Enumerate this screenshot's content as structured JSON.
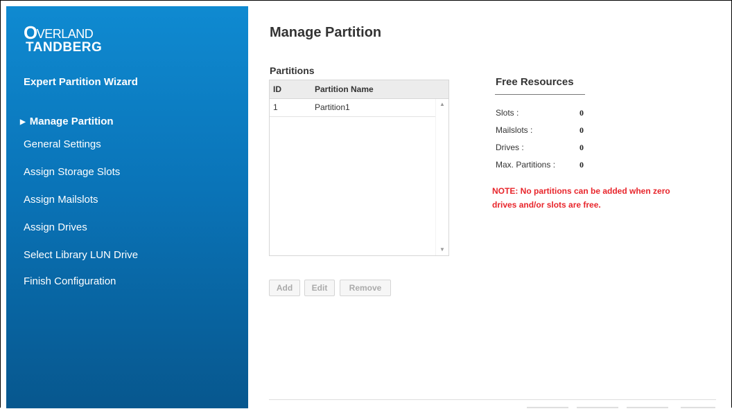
{
  "sidebar": {
    "logo_top": "VERLAND",
    "logo_o": "O",
    "logo_bottom": "TANDBERG",
    "wizard_title": "Expert Partition Wizard",
    "items": [
      {
        "label": "Manage Partition",
        "active": true
      },
      {
        "label": "General Settings"
      },
      {
        "label": "Assign Storage Slots"
      },
      {
        "label": "Assign Mailslots"
      },
      {
        "label": "Assign Drives"
      },
      {
        "label": "Select Library LUN Drive"
      },
      {
        "label": "Finish Configuration"
      }
    ]
  },
  "main": {
    "title": "Manage Partition",
    "partitions_label": "Partitions",
    "table": {
      "columns": [
        "ID",
        "Partition Name"
      ],
      "rows": [
        [
          "1",
          "Partition1"
        ]
      ]
    },
    "buttons": {
      "add": "Add",
      "edit": "Edit",
      "remove": "Remove"
    }
  },
  "free_resources": {
    "title": "Free Resources",
    "items": [
      {
        "label": "Slots :",
        "value": "0"
      },
      {
        "label": "Mailslots :",
        "value": "0"
      },
      {
        "label": "Drives :",
        "value": "0"
      },
      {
        "label": "Max. Partitions :",
        "value": "0"
      }
    ],
    "note": "NOTE: No partitions can be added when zero drives and/or slots are free."
  },
  "colors": {
    "sidebar_top": "#0f8ad1",
    "sidebar_bottom": "#07578e",
    "note": "#e8252b"
  }
}
